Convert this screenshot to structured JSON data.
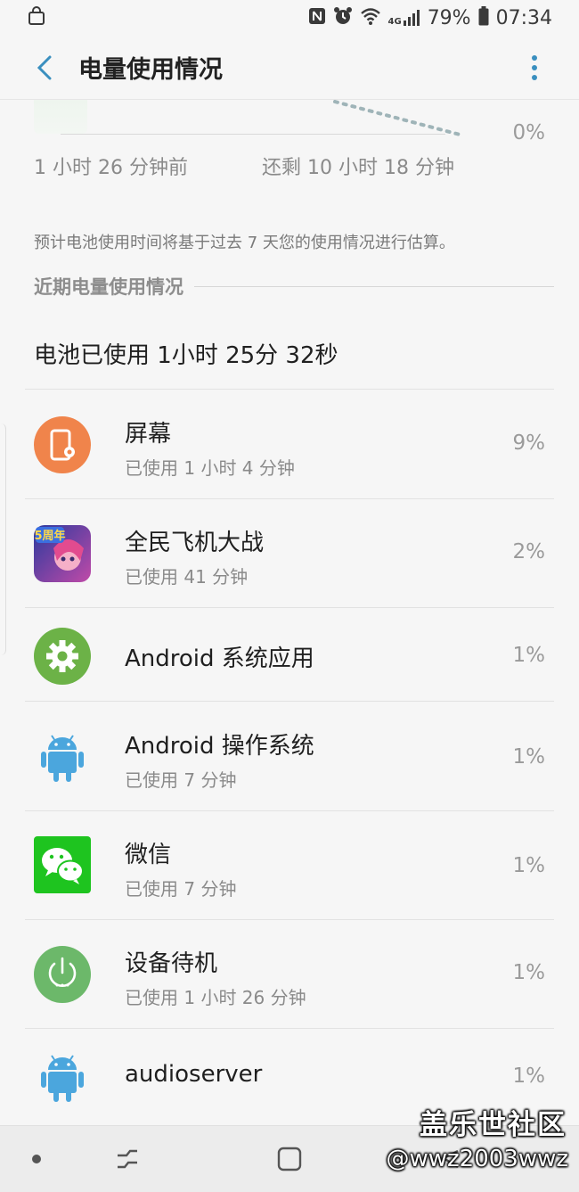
{
  "status_bar": {
    "battery_percent": "79%",
    "time": "07:34",
    "network": "4G",
    "icons": [
      "bag-icon",
      "nfc-icon",
      "alarm-icon",
      "wifi-icon",
      "signal-icon",
      "battery-icon"
    ]
  },
  "header": {
    "title": "电量使用情况"
  },
  "graph": {
    "percent_label": "0%",
    "time_left_label": "1 小时 26 分钟前",
    "time_right_label": "还剩 10 小时 18 分钟"
  },
  "estimate_note": "预计电池使用时间将基于过去 7 天您的使用情况进行估算。",
  "section": {
    "title": "近期电量使用情况"
  },
  "total_usage": "电池已使用 1小时 25分 32秒",
  "apps": [
    {
      "name": "屏幕",
      "sub": "已使用 1 小时 4 分钟",
      "percent": "9%",
      "icon": "screen-icon",
      "color": "#f0844b"
    },
    {
      "name": "全民飞机大战",
      "sub": "已使用 41 分钟",
      "percent": "2%",
      "icon": "game-icon",
      "color": "#3a4bb8",
      "badge": "5周年"
    },
    {
      "name": "Android 系统应用",
      "sub": "",
      "percent": "1%",
      "icon": "gear-icon",
      "color": "#6cb247"
    },
    {
      "name": "Android 操作系统",
      "sub": "已使用 7 分钟",
      "percent": "1%",
      "icon": "android-icon",
      "color": "#4ba6dd"
    },
    {
      "name": "微信",
      "sub": "已使用 7 分钟",
      "percent": "1%",
      "icon": "wechat-icon",
      "color": "#1ec41f"
    },
    {
      "name": "设备待机",
      "sub": "已使用 1 小时 26 分钟",
      "percent": "1%",
      "icon": "standby-icon",
      "color": "#6cb86a"
    },
    {
      "name": "audioserver",
      "sub": "",
      "percent": "1%",
      "icon": "android-icon",
      "color": "#4ba6dd"
    }
  ],
  "watermark": {
    "title": "盖乐世社区",
    "user": "@wwz2003wwz"
  }
}
